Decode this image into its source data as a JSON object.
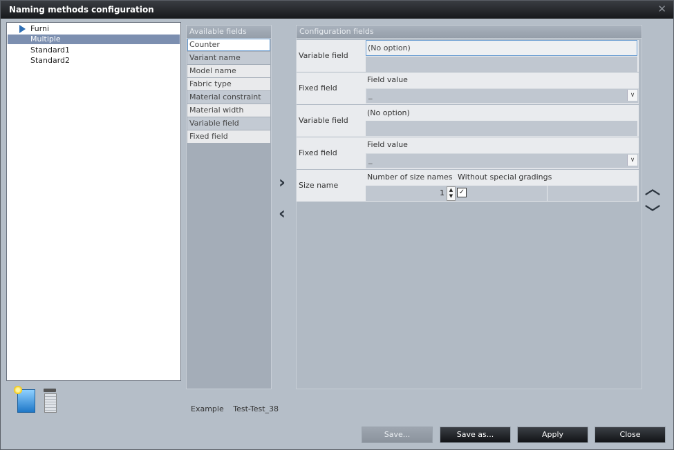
{
  "window": {
    "title": "Naming methods configuration",
    "close_glyph": "✕"
  },
  "tree": {
    "items": [
      {
        "label": "Furni",
        "expandable": true,
        "selected": false
      },
      {
        "label": "Multiple",
        "expandable": false,
        "selected": true
      },
      {
        "label": "Standard1",
        "expandable": false,
        "selected": false
      },
      {
        "label": "Standard2",
        "expandable": false,
        "selected": false
      }
    ]
  },
  "available": {
    "header": "Available fields",
    "items": [
      "Counter",
      "Variant name",
      "Model name",
      "Fabric type",
      "Material constraint",
      "Material width",
      "Variable field",
      "Fixed field"
    ]
  },
  "arrows": {
    "add": "›",
    "remove": "‹",
    "up": "︿",
    "down": "﹀"
  },
  "config": {
    "header": "Configuration fields",
    "rows": [
      {
        "label": "Variable field",
        "value": "(No option)"
      },
      {
        "label": "Fixed field",
        "sublabel": "Field value",
        "value": "_"
      },
      {
        "label": "Variable field",
        "value": "(No option)"
      },
      {
        "label": "Fixed field",
        "sublabel": "Field value",
        "value": "_"
      },
      {
        "label": "Size name",
        "col1": "Number of size names",
        "col2": "Without special gradings",
        "count": "1",
        "checked": true
      }
    ]
  },
  "example": {
    "label": "Example",
    "value": "Test-Test_38"
  },
  "buttons": {
    "save": "Save...",
    "save_as": "Save as...",
    "apply": "Apply",
    "close": "Close"
  }
}
